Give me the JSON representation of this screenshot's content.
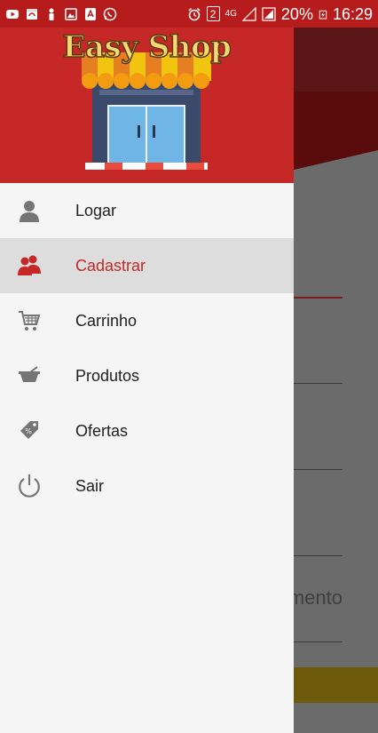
{
  "status_bar": {
    "battery": "20%",
    "time": "16:29",
    "sim_number": "2",
    "network": "4G"
  },
  "drawer": {
    "logo_text": "Easy Shop",
    "items": [
      {
        "label": "Logar",
        "icon": "person-icon"
      },
      {
        "label": "Cadastrar",
        "icon": "group-icon"
      },
      {
        "label": "Carrinho",
        "icon": "cart-icon"
      },
      {
        "label": "Produtos",
        "icon": "basket-icon"
      },
      {
        "label": "Ofertas",
        "icon": "tag-icon"
      },
      {
        "label": "Sair",
        "icon": "power-icon"
      }
    ],
    "selected_index": 1
  },
  "background": {
    "field_partial_text": "mento"
  },
  "colors": {
    "primary": "#c62828",
    "status_bar": "#b71c1c",
    "drawer_bg": "#f5f5f5",
    "selected_item_bg": "#dddddd",
    "icon_gray": "#757575"
  }
}
